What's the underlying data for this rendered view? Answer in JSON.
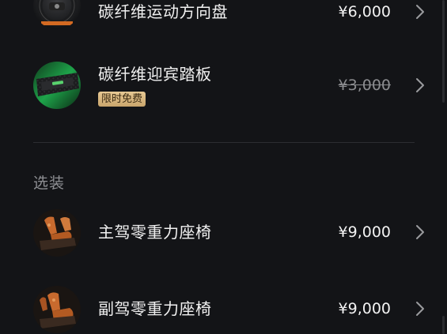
{
  "items_top": [
    {
      "name": "碳纤维运动方向盘",
      "price": "¥6,000",
      "thumb_icon": "steering-wheel-icon",
      "strikethrough": false
    },
    {
      "name": "碳纤维迎宾踏板",
      "price": "¥3,000",
      "thumb_icon": "door-sill-icon",
      "strikethrough": true,
      "badge": "限时免费"
    }
  ],
  "optional_section": {
    "title": "选装",
    "items": [
      {
        "name": "主驾零重力座椅",
        "price": "¥9,000",
        "thumb_icon": "seat-icon"
      },
      {
        "name": "副驾零重力座椅",
        "price": "¥9,000",
        "thumb_icon": "seat-icon"
      }
    ]
  },
  "icons": {
    "chevron": "chevron-right-icon"
  },
  "colors": {
    "background": "#131417",
    "text_primary": "#f1f1f1",
    "text_muted": "#8e8f93",
    "badge_gold": "#d8b77e"
  }
}
